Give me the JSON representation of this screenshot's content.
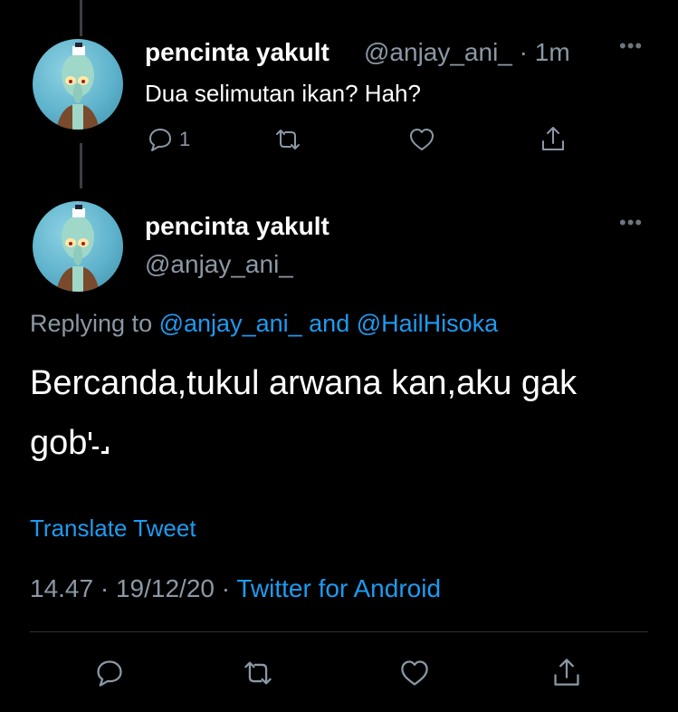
{
  "parent_tweet": {
    "display_name": "pencinta yakult",
    "handle": "@anjay_ani_",
    "separator": " · ",
    "age": "1m",
    "more_icon": "more-dots-icon",
    "text": "Dua selimutan ikan? Hah?",
    "reply_count": "1",
    "icons": [
      "reply-icon",
      "retweet-icon",
      "like-icon",
      "share-icon"
    ]
  },
  "main_tweet": {
    "display_name": "pencinta yakult",
    "handle": "@anjay_ani_",
    "more_icon": "more-dots-icon",
    "replying_prefix": "Replying to",
    "replying_user_1": "@anjay_ani_",
    "replying_joiner": "and",
    "replying_user_2": "@HailHisoka",
    "text_line_1": "Bercanda,tukul arwana kan,aku gak",
    "text_line_2": "gob",
    "translate_label": "Translate Tweet",
    "time": "14.47",
    "dot": " · ",
    "date": "19/12/20",
    "source": "Twitter for Android"
  },
  "colors": {
    "background": "#000000",
    "accent": "#1d9bf0",
    "secondary_text": "#8b98a5",
    "primary_text": "#ffffff"
  }
}
